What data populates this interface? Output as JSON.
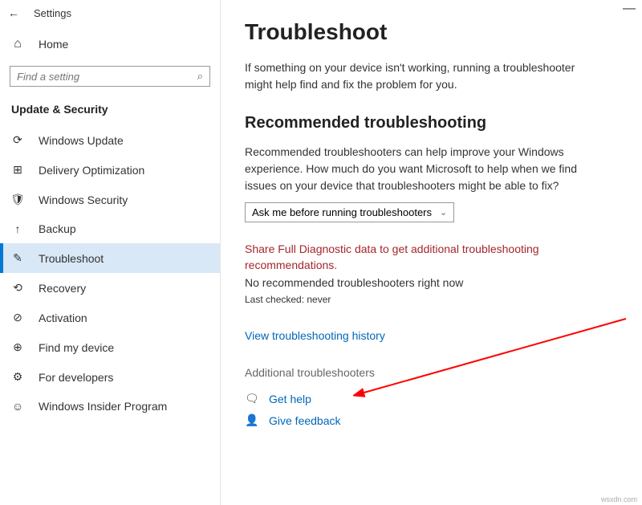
{
  "header": {
    "title": "Settings"
  },
  "home": {
    "label": "Home"
  },
  "search": {
    "placeholder": "Find a setting"
  },
  "section": {
    "title": "Update & Security"
  },
  "nav": [
    {
      "label": "Windows Update"
    },
    {
      "label": "Delivery Optimization"
    },
    {
      "label": "Windows Security"
    },
    {
      "label": "Backup"
    },
    {
      "label": "Troubleshoot"
    },
    {
      "label": "Recovery"
    },
    {
      "label": "Activation"
    },
    {
      "label": "Find my device"
    },
    {
      "label": "For developers"
    },
    {
      "label": "Windows Insider Program"
    }
  ],
  "main": {
    "title": "Troubleshoot",
    "intro": "If something on your device isn't working, running a troubleshooter might help find and fix the problem for you.",
    "rec_heading": "Recommended troubleshooting",
    "rec_text": "Recommended troubleshooters can help improve your Windows experience. How much do you want Microsoft to help when we find issues on your device that troubleshooters might be able to fix?",
    "dropdown": "Ask me before running troubleshooters",
    "warning": "Share Full Diagnostic data to get additional troubleshooting recommendations.",
    "norec": "No recommended troubleshooters right now",
    "lastcheck": "Last checked: never",
    "history_link": "View troubleshooting history",
    "additional": "Additional troubleshooters",
    "gethelp": "Get help",
    "feedback": "Give feedback"
  },
  "watermark": "wsxdn.com"
}
